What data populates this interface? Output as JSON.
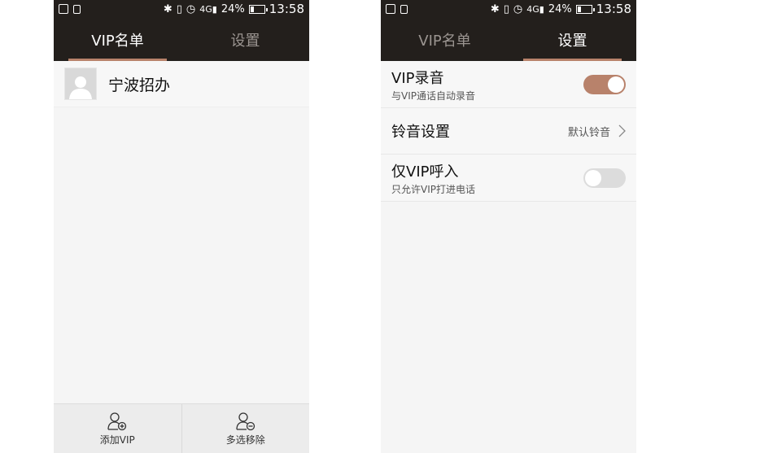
{
  "status_bar": {
    "battery": "24%",
    "time": "13:58",
    "network": "4G"
  },
  "tabs": [
    {
      "label": "VIP名单"
    },
    {
      "label": "设置"
    }
  ],
  "vip_list": [
    {
      "name": "宁波招办"
    }
  ],
  "bottom_actions": {
    "add": "添加VIP",
    "multi_remove": "多选移除"
  },
  "settings": {
    "record": {
      "title": "VIP录音",
      "subtitle": "与VIP通话自动录音",
      "enabled": true
    },
    "ringtone": {
      "title": "铃音设置",
      "value": "默认铃音"
    },
    "vip_only": {
      "title": "仅VIP呼入",
      "subtitle": "只允许VIP打进电话",
      "enabled": false
    }
  },
  "colors": {
    "header_bg": "#231f1c",
    "accent": "#b8826b",
    "page_bg": "#f5f5f5"
  }
}
